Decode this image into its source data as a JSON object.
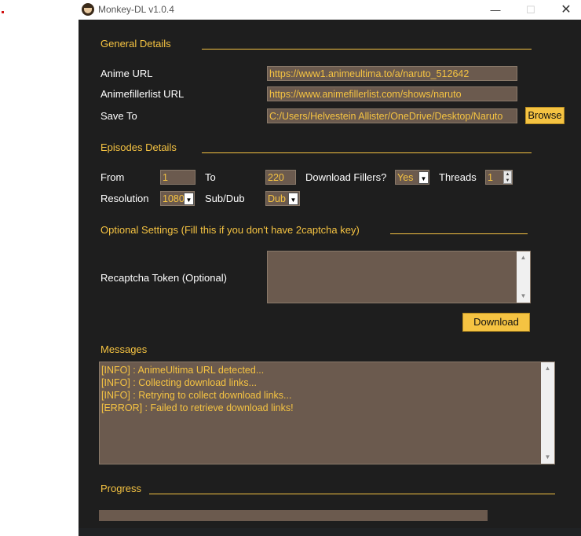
{
  "window": {
    "title": "Monkey-DL v1.0.4",
    "minimize": "—",
    "maximize": "☐",
    "close": "✕"
  },
  "general": {
    "heading": "General Details",
    "anime_url_label": "Anime URL",
    "anime_url_value": "https://www1.animeultima.to/a/naruto_512642",
    "filler_url_label": "Animefillerlist URL",
    "filler_url_value": "https://www.animefillerlist.com/shows/naruto",
    "save_to_label": "Save To",
    "save_to_value": "C:/Users/Helvestein Allister/OneDrive/Desktop/Naruto",
    "browse_label": "Browse"
  },
  "episodes": {
    "heading": "Episodes Details",
    "from_label": "From",
    "from_value": "1",
    "to_label": "To",
    "to_value": "220",
    "fillers_label": "Download Fillers?",
    "fillers_value": "Yes",
    "threads_label": "Threads",
    "threads_value": "1",
    "resolution_label": "Resolution",
    "resolution_value": "1080",
    "subdub_label": "Sub/Dub",
    "subdub_value": "Dub"
  },
  "optional": {
    "heading": "Optional Settings (Fill this if you don't have 2captcha key)",
    "recaptcha_label": "Recaptcha Token (Optional)",
    "recaptcha_value": ""
  },
  "download_label": "Download",
  "messages": {
    "heading": "Messages",
    "lines": [
      "[INFO] : AnimeUltima URL detected...",
      "[INFO] : Collecting download links...",
      "[INFO] : Retrying to collect download links...",
      "[ERROR] : Failed to retrieve download links!"
    ]
  },
  "progress": {
    "heading": "Progress",
    "fraction": 0
  },
  "colors": {
    "accent": "#f5c342",
    "window_bg": "#1e1e1e",
    "field_bg": "#6b5a4e"
  }
}
